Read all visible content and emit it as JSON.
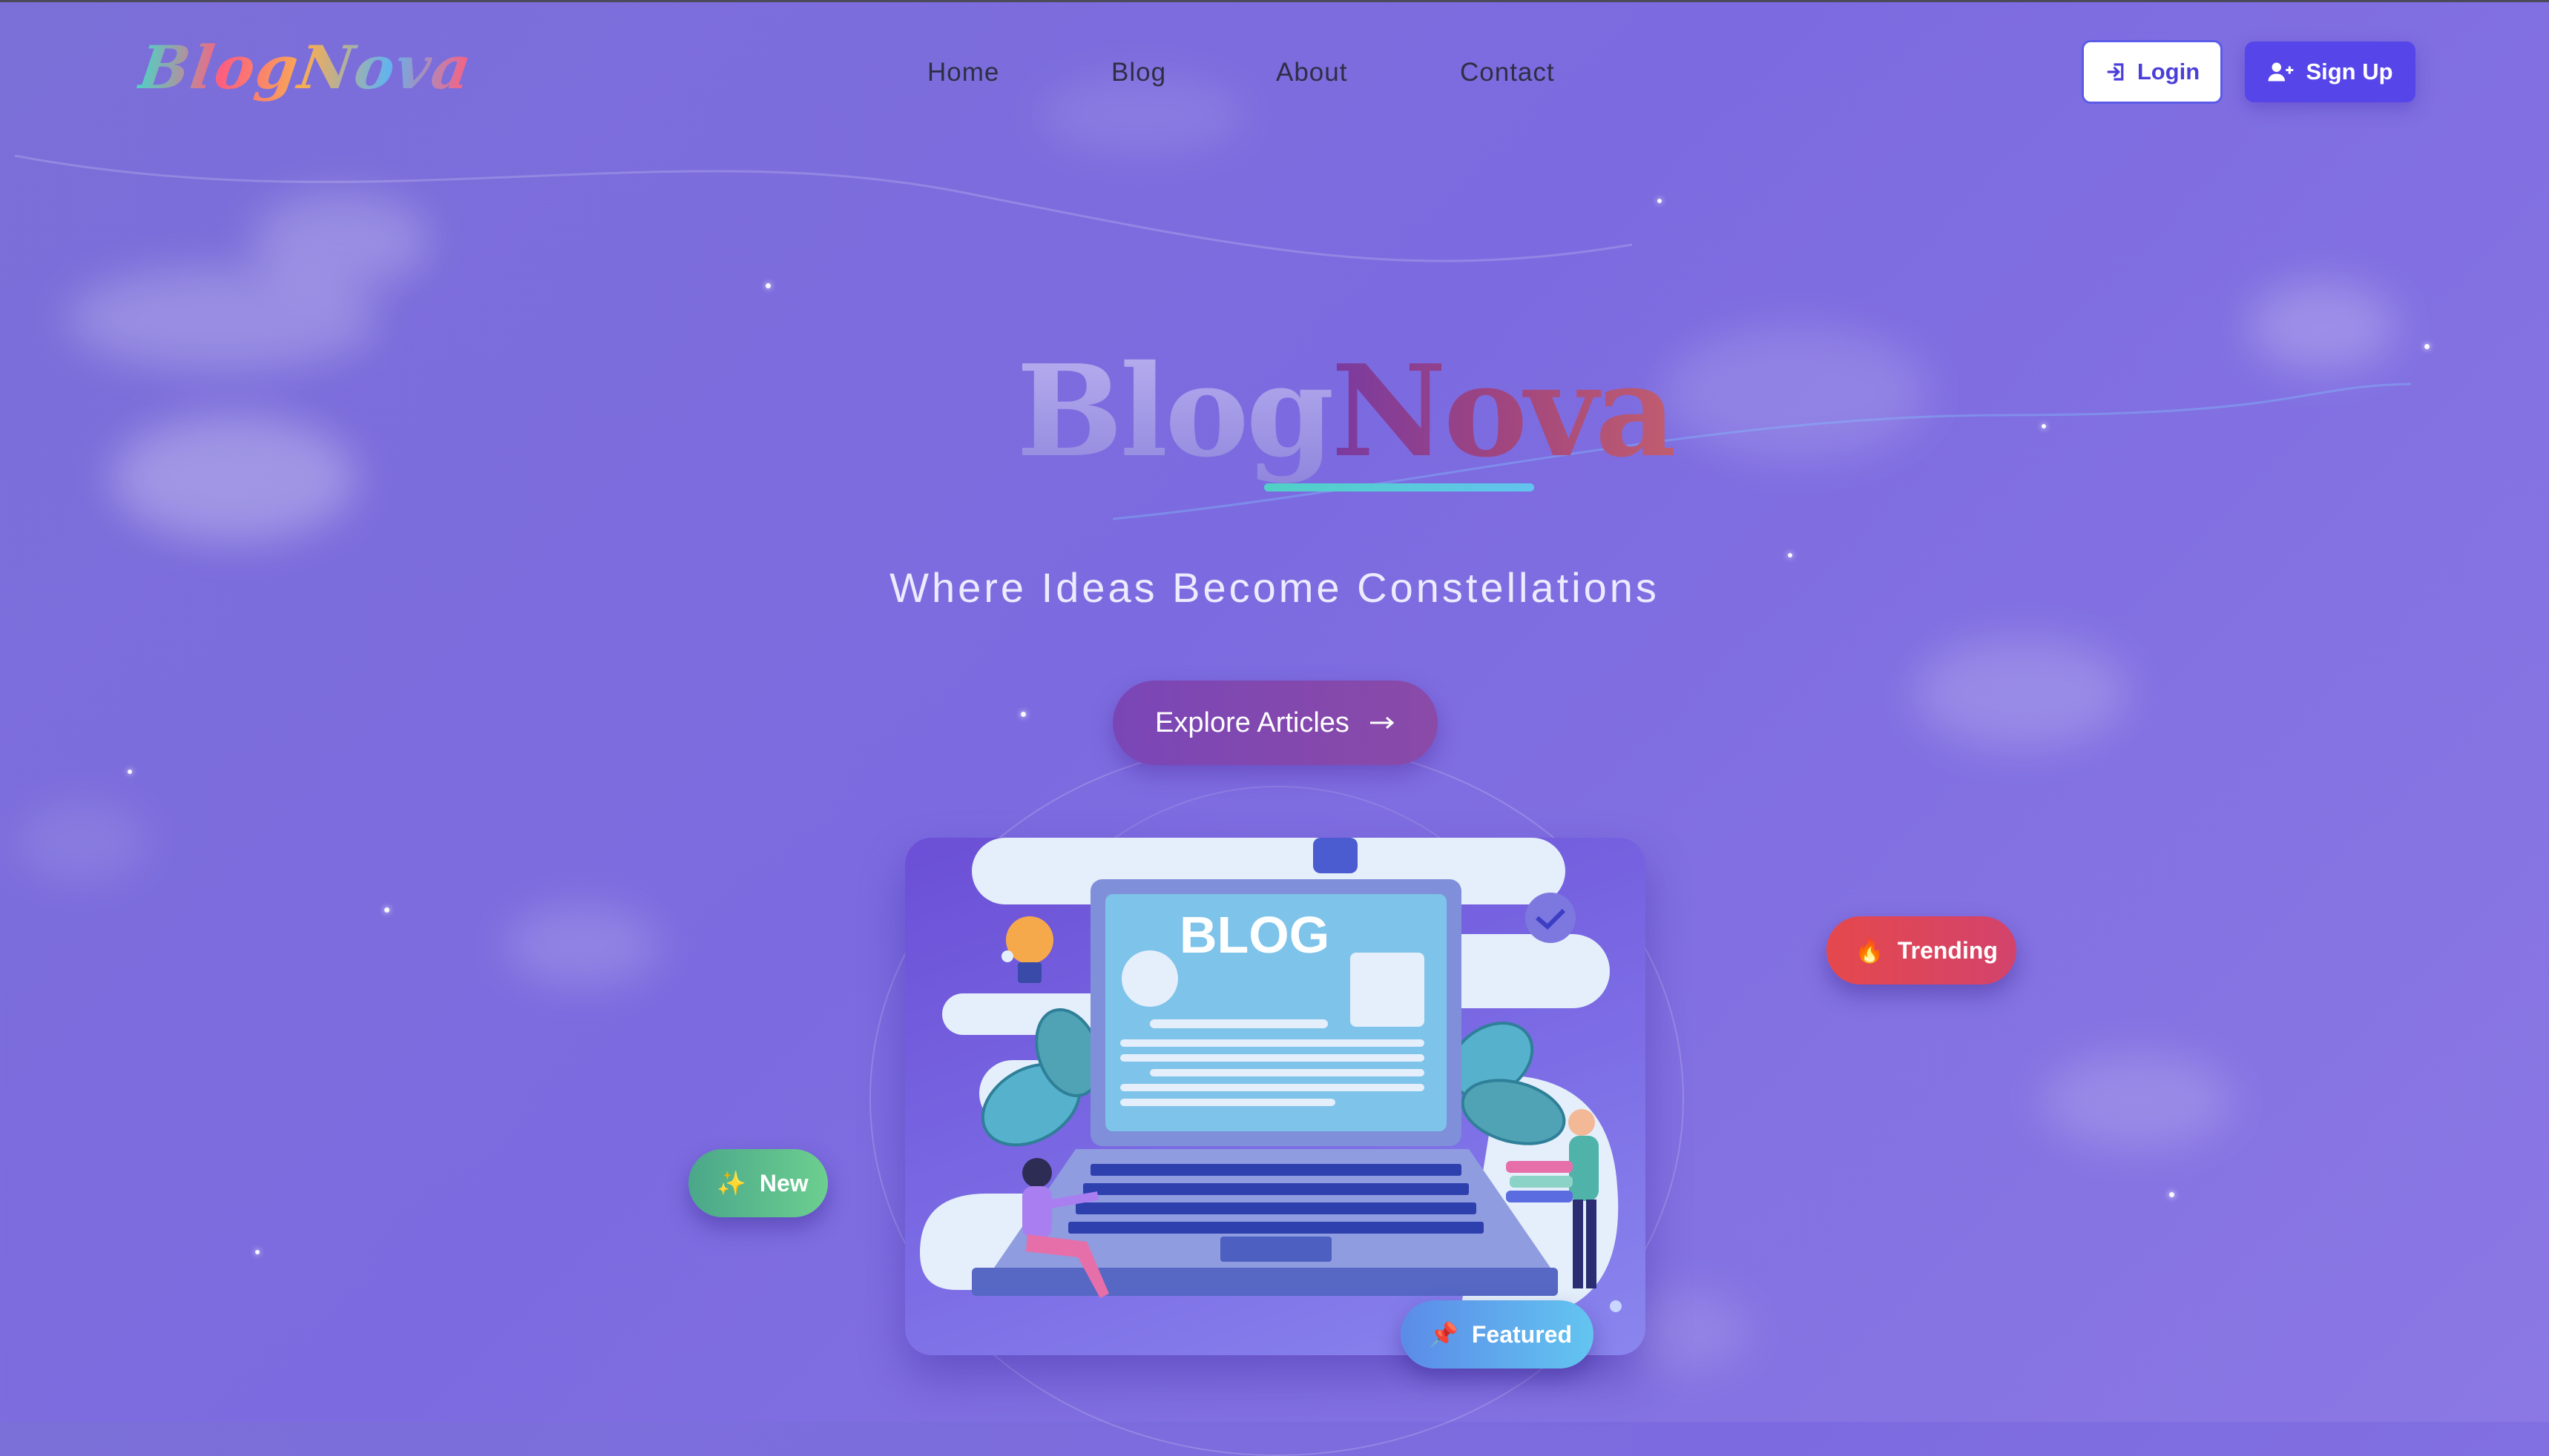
{
  "logo": {
    "text": "BlogNova"
  },
  "nav": {
    "items": [
      {
        "label": "Home"
      },
      {
        "label": "Blog"
      },
      {
        "label": "About"
      },
      {
        "label": "Contact"
      }
    ]
  },
  "auth": {
    "login_label": "Login",
    "signup_label": "Sign Up",
    "login_icon": "login-arrow-icon",
    "signup_icon": "user-plus-icon"
  },
  "hero": {
    "title_part1": "Blog",
    "title_part2": "Nova",
    "tagline": "Where Ideas Become Constellations",
    "cta_label": "Explore Articles",
    "cta_icon": "arrow-right-icon"
  },
  "illustration": {
    "screen_text": "BLOG"
  },
  "badges": {
    "trending": {
      "label": "Trending",
      "icon": "fire-icon"
    },
    "new": {
      "label": "New",
      "icon": "sparkles-icon"
    },
    "featured": {
      "label": "Featured",
      "icon": "pin-icon"
    }
  },
  "colors": {
    "accent": "#5646ea",
    "trending": "#e5484d",
    "new": "#4aa78a",
    "featured": "#5b8be8"
  }
}
